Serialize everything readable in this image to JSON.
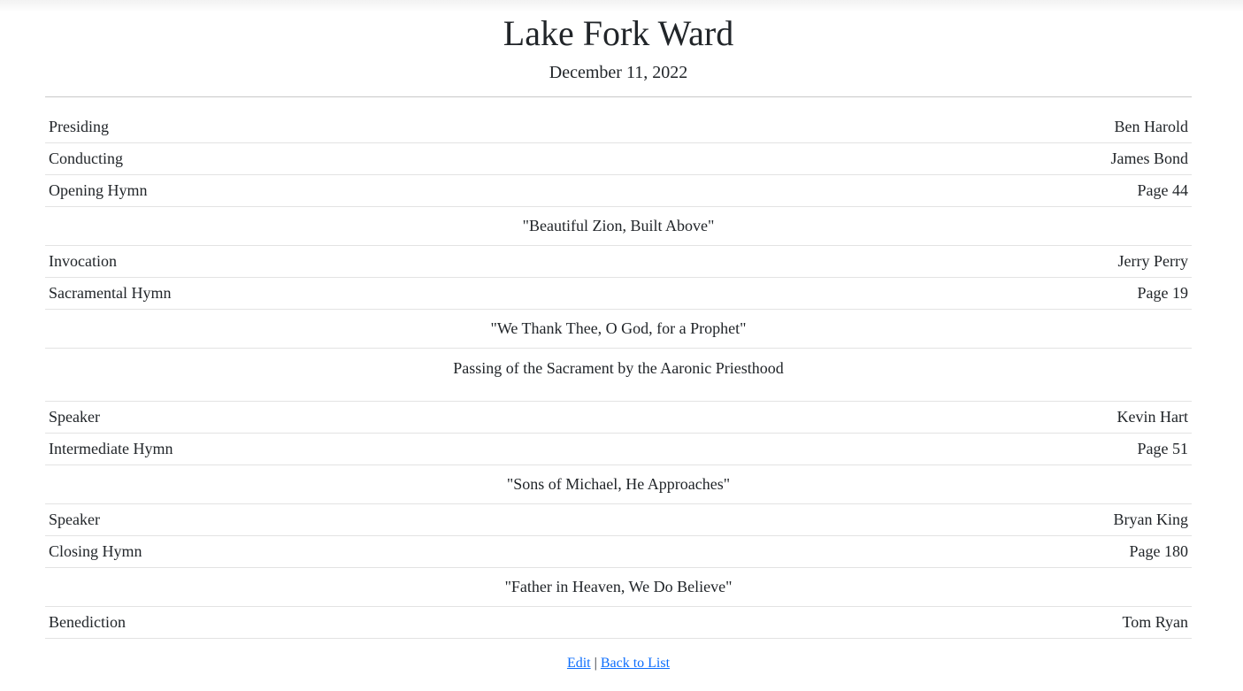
{
  "header": {
    "title": "Lake Fork Ward",
    "date": "December 11, 2022"
  },
  "program": {
    "presiding": {
      "label": "Presiding",
      "value": "Ben Harold"
    },
    "conducting": {
      "label": "Conducting",
      "value": "James Bond"
    },
    "opening_hymn": {
      "label": "Opening Hymn",
      "value": "Page 44",
      "title": "\"Beautiful Zion, Built Above\""
    },
    "invocation": {
      "label": "Invocation",
      "value": "Jerry Perry"
    },
    "sacramental_hymn": {
      "label": "Sacramental Hymn",
      "value": "Page 19",
      "title": "\"We Thank Thee, O God, for a Prophet\""
    },
    "sacrament_note": "Passing of the Sacrament by the Aaronic Priesthood",
    "speaker_1": {
      "label": "Speaker",
      "value": "Kevin Hart"
    },
    "intermediate_hymn": {
      "label": "Intermediate Hymn",
      "value": "Page 51",
      "title": "\"Sons of Michael, He Approaches\""
    },
    "speaker_2": {
      "label": "Speaker",
      "value": "Bryan King"
    },
    "closing_hymn": {
      "label": "Closing Hymn",
      "value": "Page 180",
      "title": "\"Father in Heaven, We Do Believe\""
    },
    "benediction": {
      "label": "Benediction",
      "value": "Tom Ryan"
    }
  },
  "footer": {
    "edit_label": "Edit",
    "separator": "|",
    "back_label": "Back to List"
  }
}
